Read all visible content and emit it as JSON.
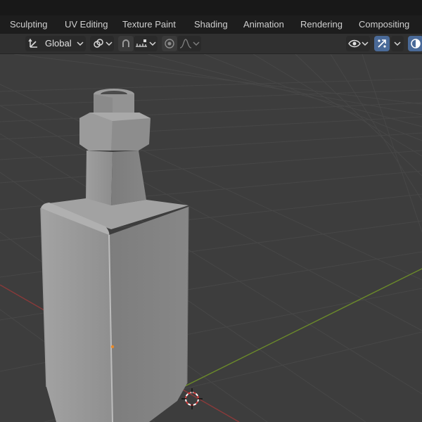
{
  "workspace_tabs": [
    {
      "label": "Sculpting"
    },
    {
      "label": "UV Editing"
    },
    {
      "label": "Texture Paint"
    },
    {
      "label": "Shading"
    },
    {
      "label": "Animation"
    },
    {
      "label": "Rendering"
    },
    {
      "label": "Compositing"
    }
  ],
  "toolbar": {
    "transform_orientation": "Global",
    "accent_color": "#4a6a98"
  },
  "viewport": {
    "object": "bottle",
    "background_color": "#3d3d3d",
    "grid_color": "#474747",
    "x_axis_color": "#8a3a3a",
    "y_axis_color": "#6b8a2a"
  }
}
